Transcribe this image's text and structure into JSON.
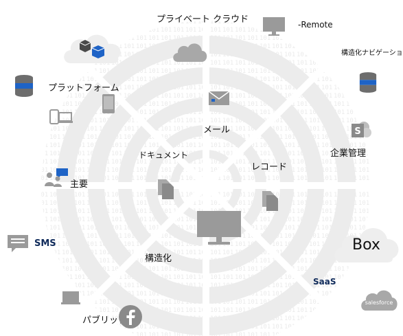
{
  "labels": {
    "private_cloud": "プライベート クラウド",
    "remote": "-Remote",
    "structured_nav": "構造化ナビゲーション",
    "platform": "プラットフォーム",
    "mail": "メール",
    "enterprise_mgmt": "企業管理",
    "document": "ドキュメント",
    "record": "レコード",
    "main": "主要",
    "sms": "SMS",
    "box": "Box",
    "structured": "構造化",
    "saas": "SaaS",
    "public": "パブリック",
    "salesforce": "salesforce"
  },
  "colors": {
    "accent_blue": "#1e63c6",
    "icon_gray": "#9a9a9a",
    "ring_gray": "#eeeeee",
    "binary_gray": "#d7d7d7",
    "dark_text": "#0f2a5a"
  },
  "icons": [
    "database-icon",
    "monitor-icon",
    "cloud-icon",
    "cloud-boxes-icon",
    "mail-icon",
    "phone-icon",
    "devices-icon",
    "sharepoint-icon",
    "chat-users-icon",
    "documents-icon",
    "message-icon",
    "box-cloud-icon",
    "salesforce-cloud-icon",
    "facebook-icon",
    "laptop-icon"
  ]
}
